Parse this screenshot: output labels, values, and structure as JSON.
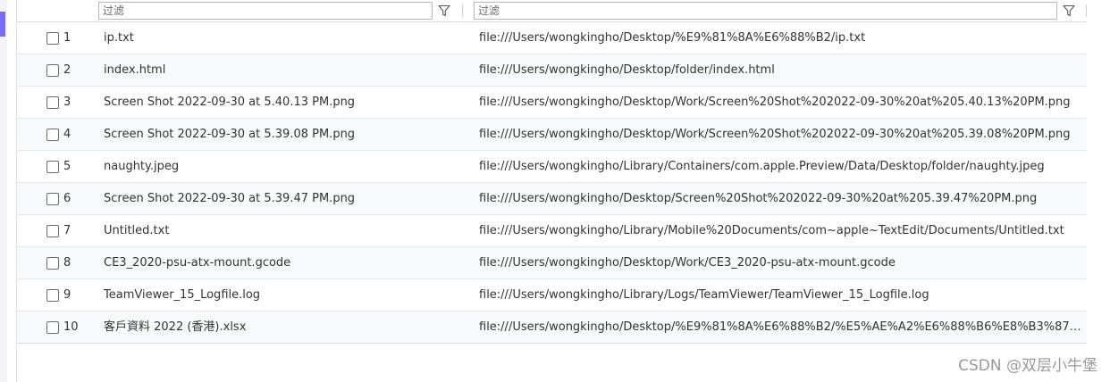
{
  "filters": {
    "name_placeholder": "过滤",
    "path_placeholder": "过滤"
  },
  "rows": [
    {
      "num": "1",
      "name": "ip.txt",
      "path": "file:///Users/wongkingho/Desktop/%E9%81%8A%E6%88%B2/ip.txt"
    },
    {
      "num": "2",
      "name": "index.html",
      "path": "file:///Users/wongkingho/Desktop/folder/index.html"
    },
    {
      "num": "3",
      "name": "Screen Shot 2022-09-30 at 5.40.13 PM.png",
      "path": "file:///Users/wongkingho/Desktop/Work/Screen%20Shot%202022-09-30%20at%205.40.13%20PM.png"
    },
    {
      "num": "4",
      "name": "Screen Shot 2022-09-30 at 5.39.08 PM.png",
      "path": "file:///Users/wongkingho/Desktop/Work/Screen%20Shot%202022-09-30%20at%205.39.08%20PM.png"
    },
    {
      "num": "5",
      "name": "naughty.jpeg",
      "path": "file:///Users/wongkingho/Library/Containers/com.apple.Preview/Data/Desktop/folder/naughty.jpeg"
    },
    {
      "num": "6",
      "name": "Screen Shot 2022-09-30 at 5.39.47 PM.png",
      "path": "file:///Users/wongkingho/Desktop/Screen%20Shot%202022-09-30%20at%205.39.47%20PM.png"
    },
    {
      "num": "7",
      "name": "Untitled.txt",
      "path": "file:///Users/wongkingho/Library/Mobile%20Documents/com~apple~TextEdit/Documents/Untitled.txt"
    },
    {
      "num": "8",
      "name": "CE3_2020-psu-atx-mount.gcode",
      "path": "file:///Users/wongkingho/Desktop/Work/CE3_2020-psu-atx-mount.gcode"
    },
    {
      "num": "9",
      "name": "TeamViewer_15_Logfile.log",
      "path": "file:///Users/wongkingho/Library/Logs/TeamViewer/TeamViewer_15_Logfile.log"
    },
    {
      "num": "10",
      "name": "客戶資料 2022 (香港).xlsx",
      "path": "file:///Users/wongkingho/Desktop/%E9%81%8A%E6%88%B2/%E5%AE%A2%E6%88%B6%E8%B3%87%E6%..."
    }
  ],
  "watermark": "CSDN @双层小牛堡",
  "colors": {
    "accent": "#7b6cf6",
    "row_alt": "#f8f9fb",
    "border": "#e6e6e6"
  },
  "icons": {
    "filter": "funnel-icon",
    "checkbox": "checkbox-icon"
  }
}
